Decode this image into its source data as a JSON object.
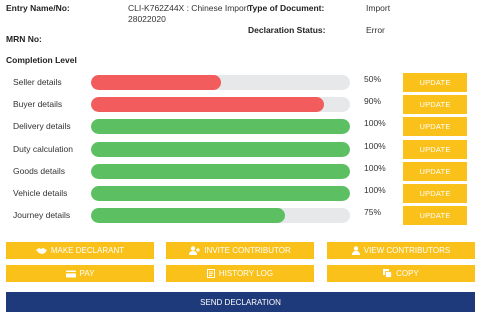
{
  "header": {
    "entry_label": "Entry Name/No:",
    "entry_value_line1": "CLI-K762Z44X : Chinese Import",
    "entry_value_line2": "28022020",
    "mrn_label": "MRN No:",
    "doc_type_label": "Type of Document:",
    "doc_type_value": "Import",
    "status_label": "Declaration Status:",
    "status_value": "Error"
  },
  "completion": {
    "title": "Completion Level",
    "update_label": "UPDATE",
    "rows": [
      {
        "label": "Seller details",
        "percent": 50,
        "percent_text": "50%",
        "color": "#f25c5c"
      },
      {
        "label": "Buyer details",
        "percent": 90,
        "percent_text": "90%",
        "color": "#f25c5c"
      },
      {
        "label": "Delivery details",
        "percent": 100,
        "percent_text": "100%",
        "color": "#5cc062"
      },
      {
        "label": "Duty calculation",
        "percent": 100,
        "percent_text": "100%",
        "color": "#5cc062"
      },
      {
        "label": "Goods details",
        "percent": 100,
        "percent_text": "100%",
        "color": "#5cc062"
      },
      {
        "label": "Vehicle details",
        "percent": 100,
        "percent_text": "100%",
        "color": "#5cc062"
      },
      {
        "label": "Journey details",
        "percent": 75,
        "percent_text": "75%",
        "color": "#5cc062"
      }
    ]
  },
  "actions": {
    "make_declarant": "MAKE DECLARANT",
    "invite_contributor": "INVITE CONTRIBUTOR",
    "view_contributors": "VIEW CONTRIBUTORS",
    "pay": "PAY",
    "history_log": "HISTORY LOG",
    "copy": "COPY",
    "send_declaration": "SEND DECLARATION"
  },
  "colors": {
    "accent": "#f9c11a",
    "primary": "#1f3a7a",
    "error_bar": "#f25c5c",
    "success_bar": "#5cc062"
  }
}
